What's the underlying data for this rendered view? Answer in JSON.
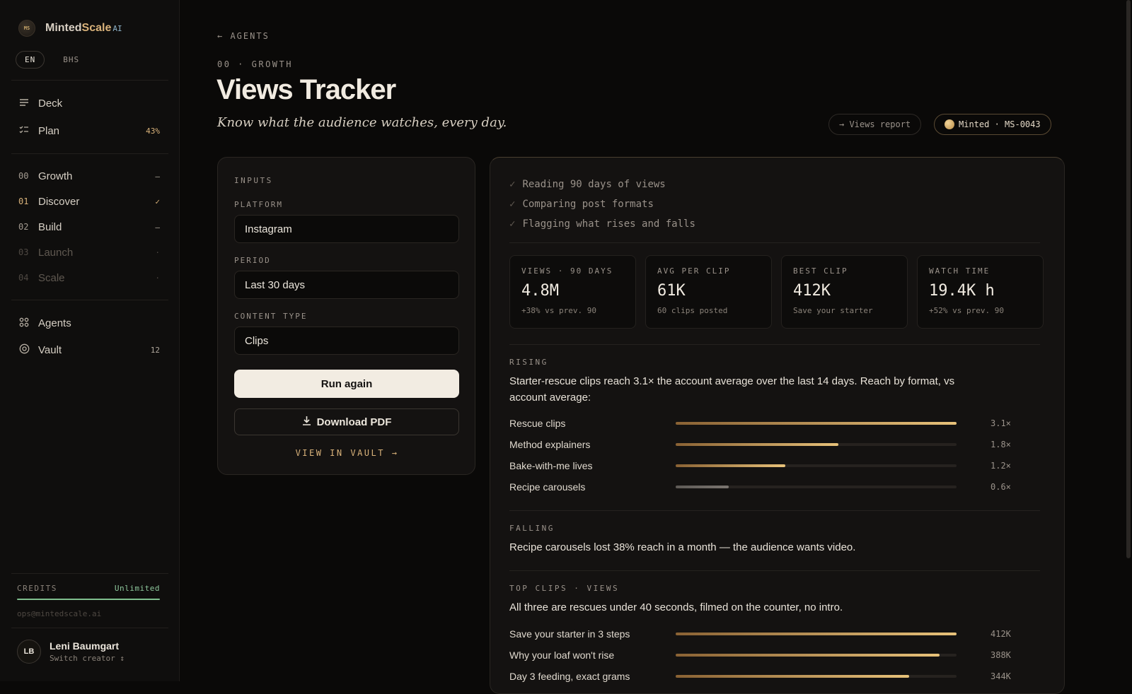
{
  "brand": {
    "logo_text": "MS",
    "name_part1": "Minted",
    "name_part2": "Scale",
    "name_suffix": "AI"
  },
  "languages": [
    "EN",
    "BHS"
  ],
  "nav_top": [
    {
      "label": "Deck",
      "icon": "menu-lines-icon",
      "badge": ""
    },
    {
      "label": "Plan",
      "icon": "checklist-icon",
      "badge": "43%"
    }
  ],
  "stages": [
    {
      "index": "00",
      "label": "Growth",
      "status": "–"
    },
    {
      "index": "01",
      "label": "Discover",
      "status": "✓"
    },
    {
      "index": "02",
      "label": "Build",
      "status": "–"
    },
    {
      "index": "03",
      "label": "Launch",
      "status": "·"
    },
    {
      "index": "04",
      "label": "Scale",
      "status": "·"
    }
  ],
  "nav_bottom": [
    {
      "label": "Agents",
      "icon": "grid-icon",
      "badge": ""
    },
    {
      "label": "Vault",
      "icon": "vault-icon",
      "badge": "12"
    }
  ],
  "credits": {
    "label": "CREDITS",
    "value": "Unlimited",
    "email": "ops@mintedscale.ai"
  },
  "user": {
    "initials": "LB",
    "name": "Leni Baumgart",
    "sub": "Switch creator ↕"
  },
  "header": {
    "back": "← AGENTS",
    "eyebrow": "00 · GROWTH",
    "title": "Views Tracker",
    "tagline": "Know what the audience watches, every day.",
    "report_button": "→ Views report",
    "minted_badge": "Minted · MS-0043"
  },
  "inputs": {
    "section_label": "INPUTS",
    "platform_label": "PLATFORM",
    "platform_value": "Instagram",
    "period_label": "PERIOD",
    "period_value": "Last 30 days",
    "content_label": "CONTENT TYPE",
    "content_value": "Clips",
    "run_button": "Run again",
    "download_button": "Download PDF",
    "vault_link": "VIEW IN VAULT →"
  },
  "progress_steps": [
    "Reading 90 days of views",
    "Comparing post formats",
    "Flagging what rises and falls"
  ],
  "metrics": [
    {
      "label": "VIEWS · 90 DAYS",
      "value": "4.8M",
      "sub": "+38% vs prev. 90"
    },
    {
      "label": "AVG PER CLIP",
      "value": "61K",
      "sub": "60 clips posted"
    },
    {
      "label": "BEST CLIP",
      "value": "412K",
      "sub": "Save your starter"
    },
    {
      "label": "WATCH TIME",
      "value": "19.4K h",
      "sub": "+52% vs prev. 90"
    }
  ],
  "rising": {
    "label": "RISING",
    "text": "Starter-rescue clips reach 3.1× the account average over the last 14 days. Reach by format, vs account average:",
    "bars": [
      {
        "label": "Rescue clips",
        "value": 3.1,
        "display": "3.1×",
        "fraction": 1.0,
        "tone": "gold"
      },
      {
        "label": "Method explainers",
        "value": 1.8,
        "display": "1.8×",
        "fraction": 0.58,
        "tone": "gold"
      },
      {
        "label": "Bake-with-me lives",
        "value": 1.2,
        "display": "1.2×",
        "fraction": 0.39,
        "tone": "gold"
      },
      {
        "label": "Recipe carousels",
        "value": 0.6,
        "display": "0.6×",
        "fraction": 0.19,
        "tone": "grey"
      }
    ]
  },
  "falling": {
    "label": "FALLING",
    "text": "Recipe carousels lost 38% reach in a month — the audience wants video."
  },
  "top_clips": {
    "label": "TOP CLIPS · VIEWS",
    "text": "All three are rescues under 40 seconds, filmed on the counter, no intro.",
    "bars": [
      {
        "label": "Save your starter in 3 steps",
        "value": 412,
        "display": "412K",
        "fraction": 1.0,
        "tone": "gold"
      },
      {
        "label": "Why your loaf won't rise",
        "value": 388,
        "display": "388K",
        "fraction": 0.94,
        "tone": "gold"
      },
      {
        "label": "Day 3 feeding, exact grams",
        "value": 344,
        "display": "344K",
        "fraction": 0.83,
        "tone": "gold"
      }
    ]
  }
}
